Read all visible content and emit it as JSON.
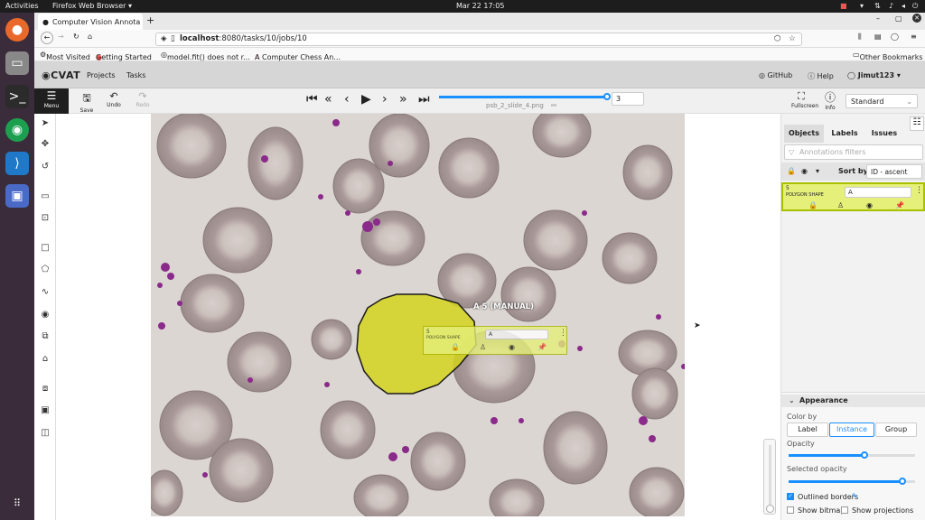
{
  "os": {
    "activities": "Activities",
    "app_menu": "Firefox Web Browser ▾",
    "clock": "Mar 22  17:05"
  },
  "browser": {
    "tab_title": "Computer Vision Annota",
    "url_host": "localhost",
    "url_rest": ":8080/tasks/10/jobs/10",
    "bookmarks": [
      "Most Visited",
      "Getting Started",
      "model.fit() does not r...",
      "A Computer Chess An..."
    ],
    "other_bookmarks": "Other Bookmarks"
  },
  "cvat": {
    "logo": "CVAT",
    "nav": [
      "Projects",
      "Tasks"
    ],
    "github": "GitHub",
    "help": "Help",
    "user": "Jimut123"
  },
  "toolbar": {
    "menu": "Menu",
    "save": "Save",
    "undo": "Undo",
    "redo": "Redo",
    "filename": "psb_2_slide_4.png",
    "frame": "3",
    "frame_progress": 1.0,
    "fullscreen": "Fullscreen",
    "info": "Info",
    "workspace": "Standard"
  },
  "canvas": {
    "shape_label": "A 5 (MANUAL)",
    "popup": {
      "id": "5",
      "type": "POLYGON SHAPE",
      "label": "A"
    }
  },
  "sidebar": {
    "tabs": [
      "Objects",
      "Labels",
      "Issues"
    ],
    "filter_placeholder": "Annotations filters",
    "sort_by": "Sort by",
    "sort_value": "ID - ascent",
    "item": {
      "id": "5",
      "type": "POLYGON SHAPE",
      "label": "A"
    },
    "appearance": {
      "title": "Appearance",
      "color_by": "Color by",
      "color_options": [
        "Label",
        "Instance",
        "Group"
      ],
      "selected_option": "Instance",
      "opacity": "Opacity",
      "opacity_value": 0.6,
      "selected_opacity": "Selected opacity",
      "selected_opacity_value": 0.9,
      "outlined": "Outlined borders",
      "show_bitmap": "Show bitmap",
      "show_projections": "Show projections"
    }
  },
  "colors": {
    "polygon": "#d4d41e",
    "accent": "#1890ff",
    "highlight": "#e5f07a"
  }
}
